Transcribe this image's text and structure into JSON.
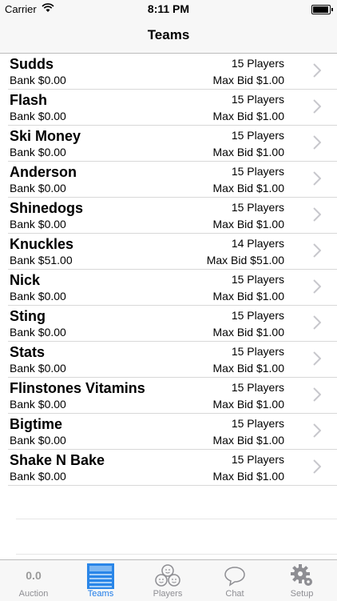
{
  "status": {
    "carrier": "Carrier",
    "time": "8:11 PM",
    "battery_level": 0.95
  },
  "nav": {
    "title": "Teams"
  },
  "teams": [
    {
      "name": "Sudds",
      "bank": "Bank $0.00",
      "players": "15 Players",
      "max_bid": "Max Bid $1.00"
    },
    {
      "name": "Flash",
      "bank": "Bank $0.00",
      "players": "15 Players",
      "max_bid": "Max Bid $1.00"
    },
    {
      "name": "Ski Money",
      "bank": "Bank $0.00",
      "players": "15 Players",
      "max_bid": "Max Bid $1.00"
    },
    {
      "name": "Anderson",
      "bank": "Bank $0.00",
      "players": "15 Players",
      "max_bid": "Max Bid $1.00"
    },
    {
      "name": "Shinedogs",
      "bank": "Bank $0.00",
      "players": "15 Players",
      "max_bid": "Max Bid $1.00"
    },
    {
      "name": "Knuckles",
      "bank": "Bank $51.00",
      "players": "14 Players",
      "max_bid": "Max Bid $51.00"
    },
    {
      "name": "Nick",
      "bank": "Bank $0.00",
      "players": "15 Players",
      "max_bid": "Max Bid $1.00"
    },
    {
      "name": "Sting",
      "bank": "Bank $0.00",
      "players": "15 Players",
      "max_bid": "Max Bid $1.00"
    },
    {
      "name": "Stats",
      "bank": "Bank $0.00",
      "players": "15 Players",
      "max_bid": "Max Bid $1.00"
    },
    {
      "name": "Flinstones Vitamins",
      "bank": "Bank $0.00",
      "players": "15 Players",
      "max_bid": "Max Bid $1.00"
    },
    {
      "name": "Bigtime",
      "bank": "Bank $0.00",
      "players": "15 Players",
      "max_bid": "Max Bid $1.00"
    },
    {
      "name": "Shake N Bake",
      "bank": "Bank $0.00",
      "players": "15 Players",
      "max_bid": "Max Bid $1.00"
    }
  ],
  "tabbar": {
    "auction": {
      "value": "0.0",
      "label": "Auction"
    },
    "teams": {
      "label": "Teams",
      "icon": "teams-board-icon"
    },
    "players": {
      "label": "Players",
      "icon": "players-icon"
    },
    "chat": {
      "label": "Chat",
      "icon": "chat-bubble-icon"
    },
    "setup": {
      "label": "Setup",
      "icon": "gear-icon"
    },
    "active_color": "#1d7be8",
    "inactive_color": "#8e8e93"
  }
}
